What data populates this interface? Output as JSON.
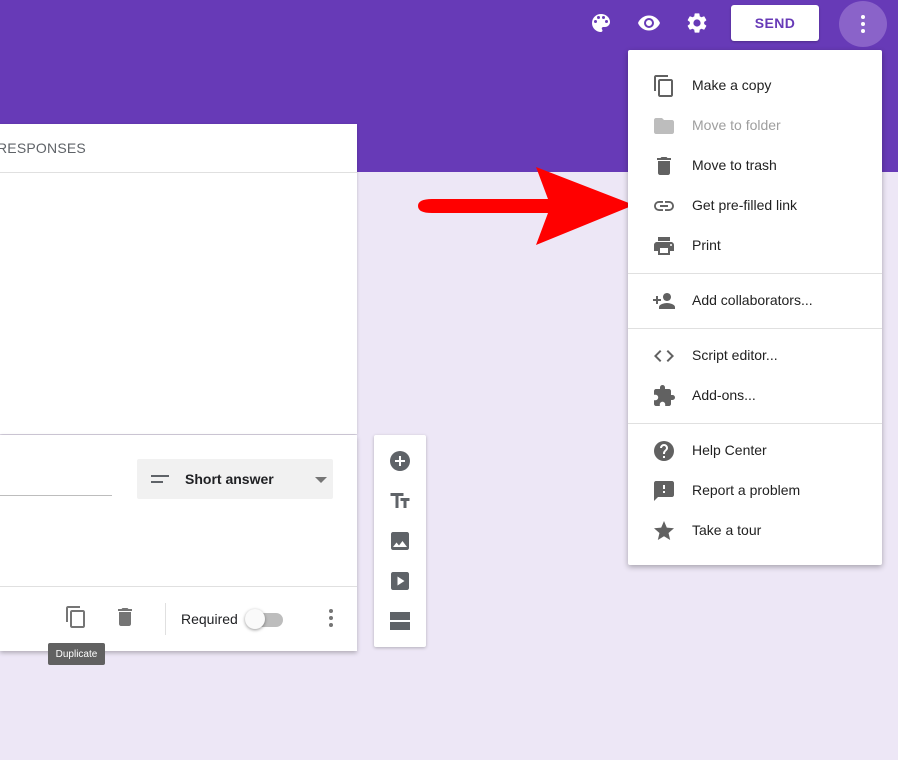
{
  "header": {
    "icons": [
      "palette-icon",
      "eye-icon",
      "gear-icon"
    ],
    "send_label": "SEND",
    "more_icon": "more-vert-icon",
    "brand_color": "#673ab7"
  },
  "tabs": {
    "responses_label": "RESPONSES"
  },
  "question": {
    "type_label": "Short answer",
    "required_label": "Required",
    "required_on": false,
    "duplicate_tooltip": "Duplicate"
  },
  "side_toolbar": {
    "tools": [
      "add-question-icon",
      "add-title-icon",
      "add-image-icon",
      "add-video-icon",
      "add-section-icon"
    ]
  },
  "menu": {
    "items": [
      {
        "label": "Make a copy",
        "icon": "copy-icon",
        "enabled": true
      },
      {
        "label": "Move to folder",
        "icon": "folder-icon",
        "enabled": false
      },
      {
        "label": "Move to trash",
        "icon": "trash-icon",
        "enabled": true
      },
      {
        "label": "Get pre-filled link",
        "icon": "link-icon",
        "enabled": true
      },
      {
        "label": "Print",
        "icon": "print-icon",
        "enabled": true
      },
      {
        "label": "Add collaborators...",
        "icon": "add-people-icon",
        "enabled": true
      },
      {
        "label": "Script editor...",
        "icon": "code-icon",
        "enabled": true
      },
      {
        "label": "Add-ons...",
        "icon": "puzzle-icon",
        "enabled": true
      },
      {
        "label": "Help Center",
        "icon": "help-icon",
        "enabled": true
      },
      {
        "label": "Report a problem",
        "icon": "feedback-icon",
        "enabled": true
      },
      {
        "label": "Take a tour",
        "icon": "star-icon",
        "enabled": true
      }
    ]
  },
  "annotation": {
    "arrow_color": "#ff0000",
    "points_to": "Get pre-filled link"
  }
}
